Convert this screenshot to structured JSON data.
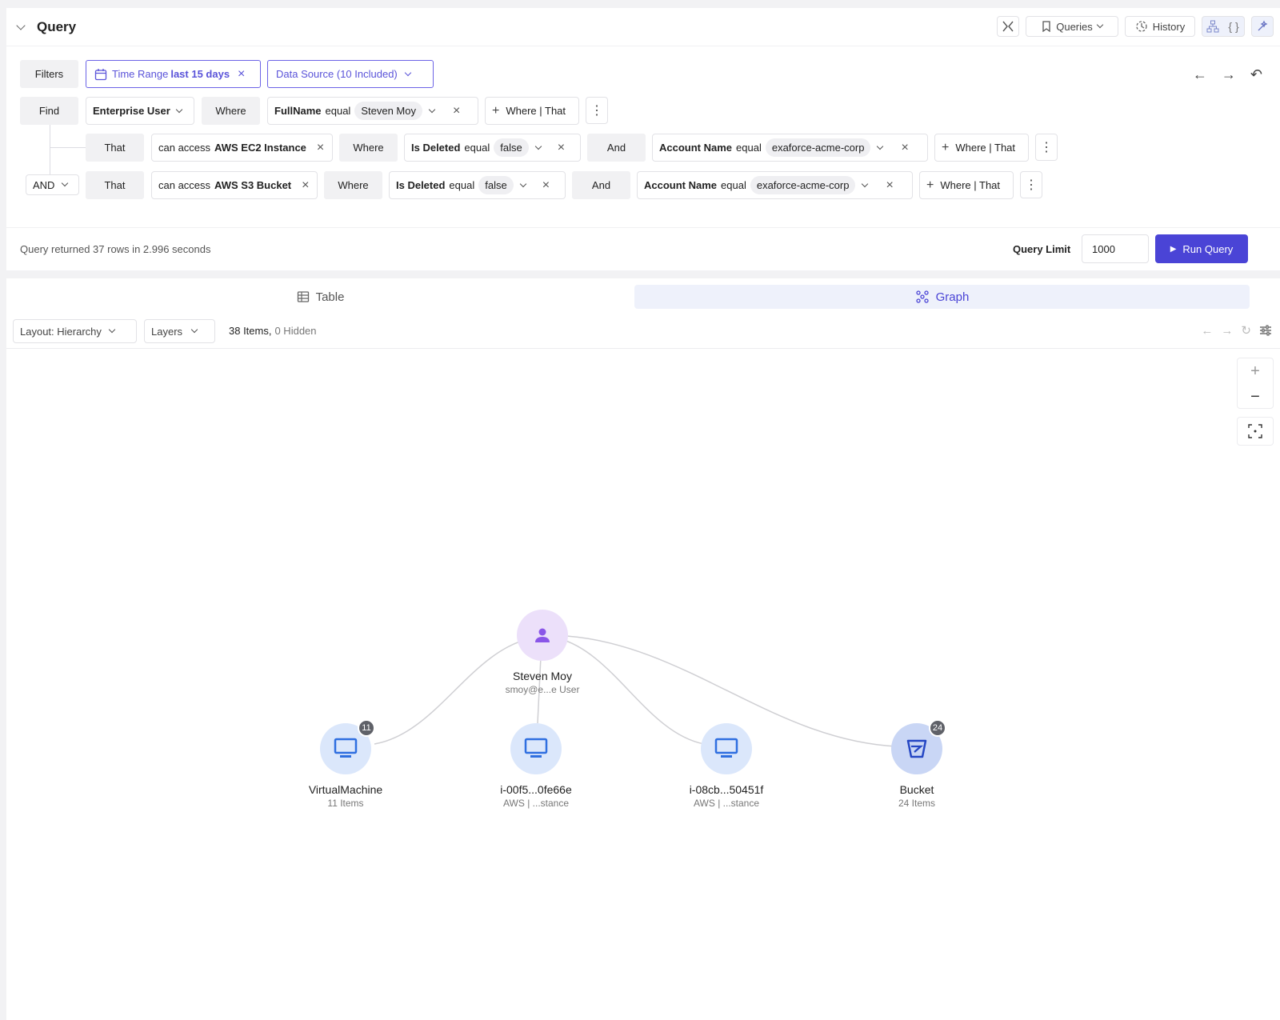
{
  "query": {
    "title": "Query",
    "toolbar": {
      "queries_label": "Queries",
      "history_label": "History"
    },
    "filters_label": "Filters",
    "time_range": {
      "label": "Time Range",
      "value": "last 15 days"
    },
    "data_source_label": "Data Source (10 Included)",
    "find_label": "Find",
    "entity": "Enterprise User",
    "where_label": "Where",
    "main_condition": {
      "field": "FullName",
      "op": "equal",
      "value": "Steven Moy"
    },
    "where_that_label": "Where | That",
    "rows": [
      {
        "that_label": "That",
        "access_prefix": "can access",
        "access_target": "AWS EC2 Instance",
        "where_label": "Where",
        "cond1": {
          "field": "Is Deleted",
          "op": "equal",
          "value": "false"
        },
        "and_label": "And",
        "cond2": {
          "field": "Account Name",
          "op": "equal",
          "value": "exaforce-acme-corp"
        },
        "add_label": "Where | That"
      },
      {
        "that_label": "That",
        "access_prefix": "can access",
        "access_target": "AWS S3 Bucket",
        "where_label": "Where",
        "cond1": {
          "field": "Is Deleted",
          "op": "equal",
          "value": "false"
        },
        "and_label": "And",
        "cond2": {
          "field": "Account Name",
          "op": "equal",
          "value": "exaforce-acme-corp"
        },
        "add_label": "Where | That"
      }
    ],
    "logic_op": "AND",
    "status": "Query returned 37 rows in 2.996 seconds",
    "limit_label": "Query Limit",
    "limit_value": "1000",
    "run_label": "Run Query"
  },
  "results": {
    "tabs": {
      "table": "Table",
      "graph": "Graph"
    },
    "layout_label": "Layout: Hierarchy",
    "layers_label": "Layers",
    "items_count": "38 Items,",
    "hidden_count": "0 Hidden"
  },
  "graph": {
    "nodes": [
      {
        "id": "user",
        "title": "Steven Moy",
        "subtitle": "smoy@e...e User",
        "icon": "user-icon"
      },
      {
        "id": "vm",
        "title": "VirtualMachine",
        "subtitle": "11 Items",
        "icon": "monitor-icon",
        "badge": "11"
      },
      {
        "id": "i1",
        "title": "i-00f5...0fe66e",
        "subtitle": "AWS | ...stance",
        "icon": "monitor-icon"
      },
      {
        "id": "i2",
        "title": "i-08cb...50451f",
        "subtitle": "AWS | ...stance",
        "icon": "monitor-icon"
      },
      {
        "id": "bucket",
        "title": "Bucket",
        "subtitle": "24 Items",
        "icon": "bucket-icon",
        "badge": "24"
      }
    ]
  },
  "colors": {
    "accent": "#4a44d6",
    "node_bg": "#dbe7fb",
    "user_bg": "#ece0fa"
  }
}
